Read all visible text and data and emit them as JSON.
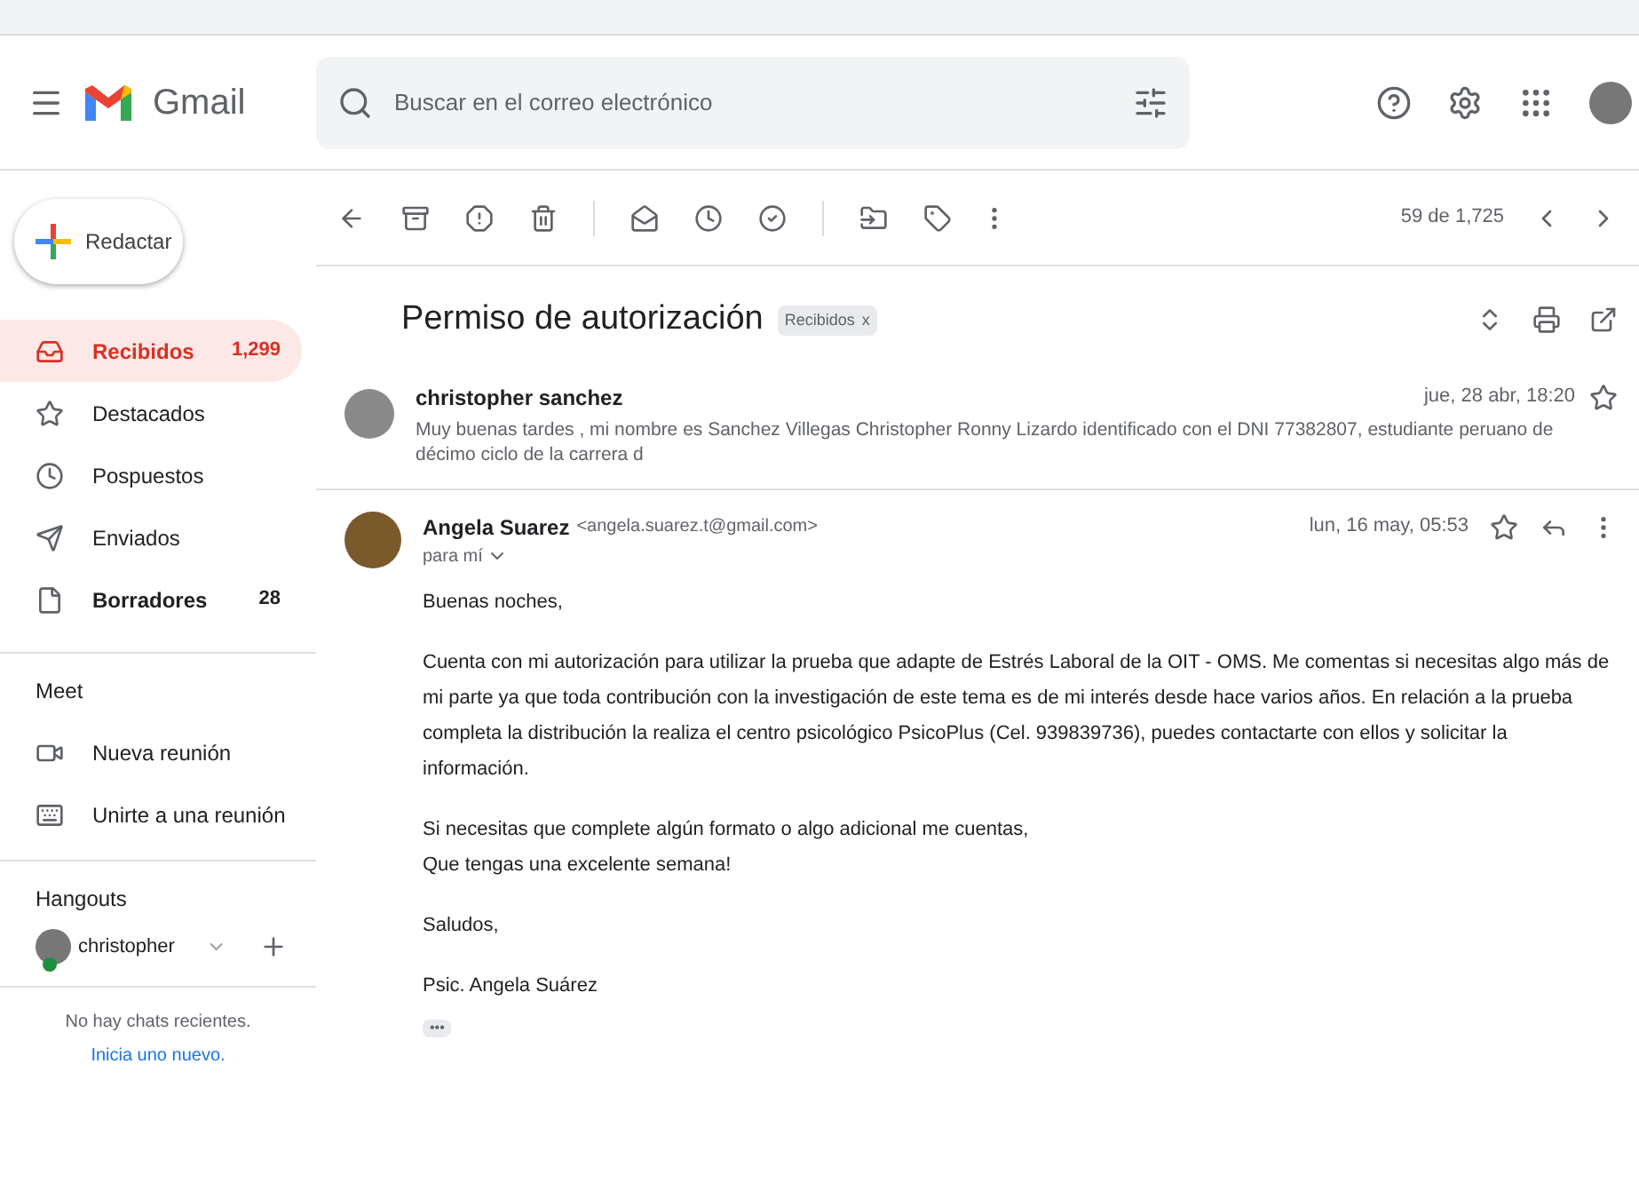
{
  "header": {
    "app_name": "Gmail",
    "search": {
      "placeholder": "Buscar en el correo electrónico"
    }
  },
  "compose": {
    "label": "Redactar"
  },
  "folders": [
    {
      "label": "Recibidos",
      "count": "1,299",
      "selected": true,
      "unread": true
    },
    {
      "label": "Destacados",
      "selected": false,
      "unread": false
    },
    {
      "label": "Pospuestos",
      "selected": false,
      "unread": false
    },
    {
      "label": "Enviados",
      "selected": false,
      "unread": false
    },
    {
      "label": "Borradores",
      "count": "28",
      "selected": false,
      "unread": true
    }
  ],
  "meet": {
    "title": "Meet",
    "items": [
      "Nueva reunión",
      "Unirte a una reunión"
    ]
  },
  "hangouts": {
    "title": "Hangouts",
    "user": "christopher",
    "online": true,
    "empty_text": "No hay chats recientes.",
    "link": "Inicia uno nuevo."
  },
  "toolbar": {
    "position": "59 de 1,725"
  },
  "thread": {
    "subject": "Permiso de autorización",
    "label": "Recibidos",
    "label_close": "x"
  },
  "messages": [
    {
      "kind": "collapsed",
      "sender": "christopher sanchez",
      "date": "jue, 28 abr, 18:20",
      "snippet": "Muy buenas tardes , mi nombre es Sanchez Villegas Christopher Ronny Lizardo identificado con el DNI 77382807, estudiante peruano de décimo ciclo de la carrera d",
      "starred": false
    },
    {
      "kind": "expanded",
      "sender": "Angela Suarez",
      "email": "<angela.suarez.t@gmail.com>",
      "recipient": "para mí",
      "date": "lun, 16 may, 05:53",
      "starred": false,
      "paragraphs": [
        [
          "Buenas noches,"
        ],
        [
          "Cuenta con mi autorización para utilizar la prueba que adapte de Estrés Laboral de la OIT - OMS. Me comentas si necesitas algo más de mi parte ya que toda contribución con la investigación de este tema es de mi interés desde hace varios años. En relación a la prueba completa la distribución la realiza el centro psicológico PsicoPlus (Cel. 939839736), puedes contactarte con ellos y solicitar la información."
        ],
        [
          "Si necesitas que complete algún formato o algo adicional me cuentas,",
          "Que tengas una excelente semana!"
        ],
        [
          "Saludos,"
        ],
        [
          "Psic. Angela Suárez"
        ]
      ],
      "more": "•••"
    }
  ]
}
